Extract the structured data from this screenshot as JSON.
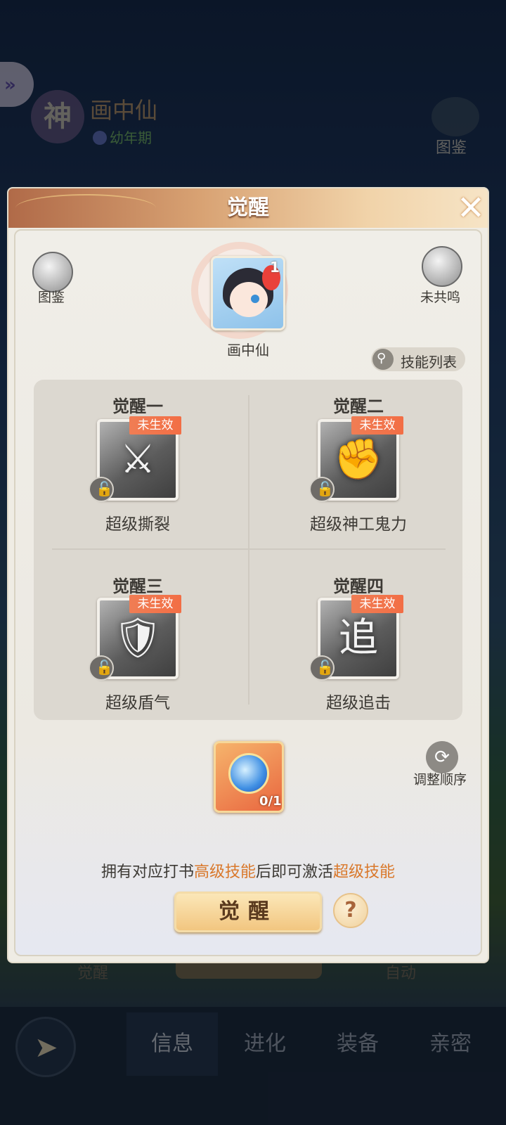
{
  "background": {
    "pet_name": "画中仙",
    "pet_stage": "幼年期",
    "rank_glyph": "神",
    "top_right_label": "图鉴",
    "behind_left_label": "觉醒",
    "behind_right_label": "自动",
    "bottom_tabs": [
      {
        "label": "信息",
        "active": true
      },
      {
        "label": "进化",
        "active": false
      },
      {
        "label": "装备",
        "active": false
      },
      {
        "label": "亲密",
        "active": false
      }
    ]
  },
  "modal": {
    "title": "觉醒",
    "close_glyph": "✕",
    "left_corner_label": "图鉴",
    "right_corner_label": "未共鸣",
    "avatar": {
      "name": "画中仙",
      "level": "1"
    },
    "skill_list_label": "技能列表",
    "awakenings": [
      {
        "title": "觉醒一",
        "status": "未生效",
        "skill": "超级撕裂",
        "icon": "claw-slash-icon",
        "glyph": "⚔"
      },
      {
        "title": "觉醒二",
        "status": "未生效",
        "skill": "超级神工鬼力",
        "icon": "fist-icon",
        "glyph": "✊"
      },
      {
        "title": "觉醒三",
        "status": "未生效",
        "skill": "超级盾气",
        "icon": "shield-spirit-icon",
        "glyph": "🛡"
      },
      {
        "title": "觉醒四",
        "status": "未生效",
        "skill": "超级追击",
        "icon": "chase-icon",
        "glyph": "追"
      }
    ],
    "item_count": "0/1",
    "reorder_label": "调整顺序",
    "hint": {
      "prefix": "拥有对应打书",
      "hl1": "高级技能",
      "middle": "后即可激活",
      "hl2": "超级技能"
    },
    "awake_button": "觉醒",
    "help_glyph": "?",
    "colors": {
      "accent": "#d9782b",
      "badge": "#f07d54"
    }
  }
}
